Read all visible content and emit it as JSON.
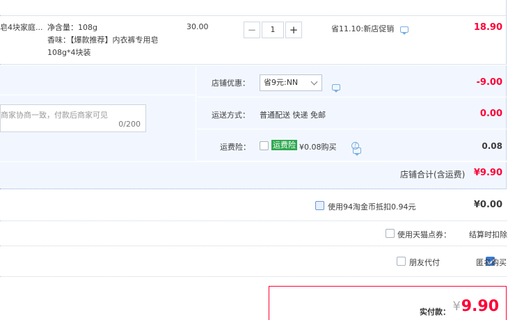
{
  "product": {
    "name_fragment": "皂4块家庭...",
    "net_content": "净含量：108g",
    "scent_line1": "香味：【爆款推荐】内衣裤专用皂",
    "scent_line2": "108g*4块装",
    "unit_price": "30.00",
    "quantity": "1",
    "qty_minus": "−",
    "qty_plus": "+",
    "promo": "省11.10:新店促销",
    "subtotal": "18.90"
  },
  "memo": {
    "placeholder": "商家协商一致，付款后商家可见",
    "count": "0/200"
  },
  "shop_discount": {
    "label": "店铺优惠：",
    "selected": "省9元:NN",
    "value": "-9.00"
  },
  "shipping": {
    "label": "运送方式：",
    "text": "普通配送 快递 免邮",
    "value": "0.00"
  },
  "freight_insurance": {
    "label": "运费险：",
    "badge": "运费险",
    "text": "¥0.08购买",
    "help": "?",
    "value": "0.08"
  },
  "shop_total": {
    "label": "店铺合计(含运费)",
    "value": "¥9.90"
  },
  "coins": {
    "text": "使用94淘金币抵扣0.94元",
    "value": "¥0.00"
  },
  "tmall_points": {
    "text": "使用天猫点券：",
    "value": "结算时扣除"
  },
  "options": {
    "friend_pay": "朋友代付",
    "anonymous": "匿名购买"
  },
  "payment": {
    "label": "实付款：",
    "currency": "¥",
    "amount": "9.90"
  },
  "colors": {
    "accent_red": "#ff0036",
    "panel_blue": "#f2f7ff",
    "badge_green": "#2fa84f",
    "check_blue": "#3779d8"
  },
  "icons": [
    "chat-icon",
    "help-icon",
    "chevron-down-icon",
    "checkbox-icon"
  ]
}
